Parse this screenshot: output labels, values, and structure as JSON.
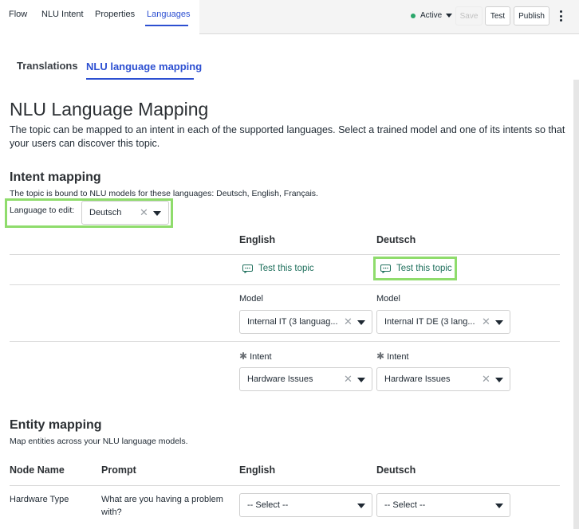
{
  "topnav": {
    "tabs": [
      {
        "label": "Flow",
        "active": false
      },
      {
        "label": "NLU Intent",
        "active": false
      },
      {
        "label": "Properties",
        "active": false
      },
      {
        "label": "Languages",
        "active": true
      }
    ],
    "status": "Active",
    "save_label": "Save",
    "test_label": "Test",
    "publish_label": "Publish"
  },
  "subtabs": [
    {
      "label": "Translations",
      "active": false
    },
    {
      "label": "NLU language mapping",
      "active": true
    }
  ],
  "page": {
    "title": "NLU Language Mapping",
    "description": "The topic can be mapped to an intent in each of the supported languages. Select a trained model and one of its intents so that your users can discover this topic."
  },
  "intent_mapping": {
    "title": "Intent mapping",
    "description": "The topic is bound to NLU models for these languages: Deutsch, English, Français.",
    "language_label": "Language to edit:",
    "language_value": "Deutsch",
    "columns": [
      "English",
      "Deutsch"
    ],
    "test_link": "Test this topic",
    "model_label": "Model",
    "models": [
      "Internal IT (3 languag...",
      "Internal IT DE (3 lang..."
    ],
    "intent_label": "Intent",
    "intents": [
      "Hardware Issues",
      "Hardware Issues"
    ]
  },
  "entity_mapping": {
    "title": "Entity mapping",
    "description": "Map entities across your NLU language models.",
    "columns": [
      "Node Name",
      "Prompt",
      "English",
      "Deutsch"
    ],
    "rows": [
      {
        "node_name": "Hardware Type",
        "prompt": "What are you having a problem with?",
        "english": "-- Select --",
        "deutsch": "-- Select --"
      }
    ]
  },
  "colors": {
    "accent": "#2c4fd1",
    "link": "#1e6f5c",
    "status_active": "#2aa66a",
    "highlight": "#8fdc6c"
  }
}
